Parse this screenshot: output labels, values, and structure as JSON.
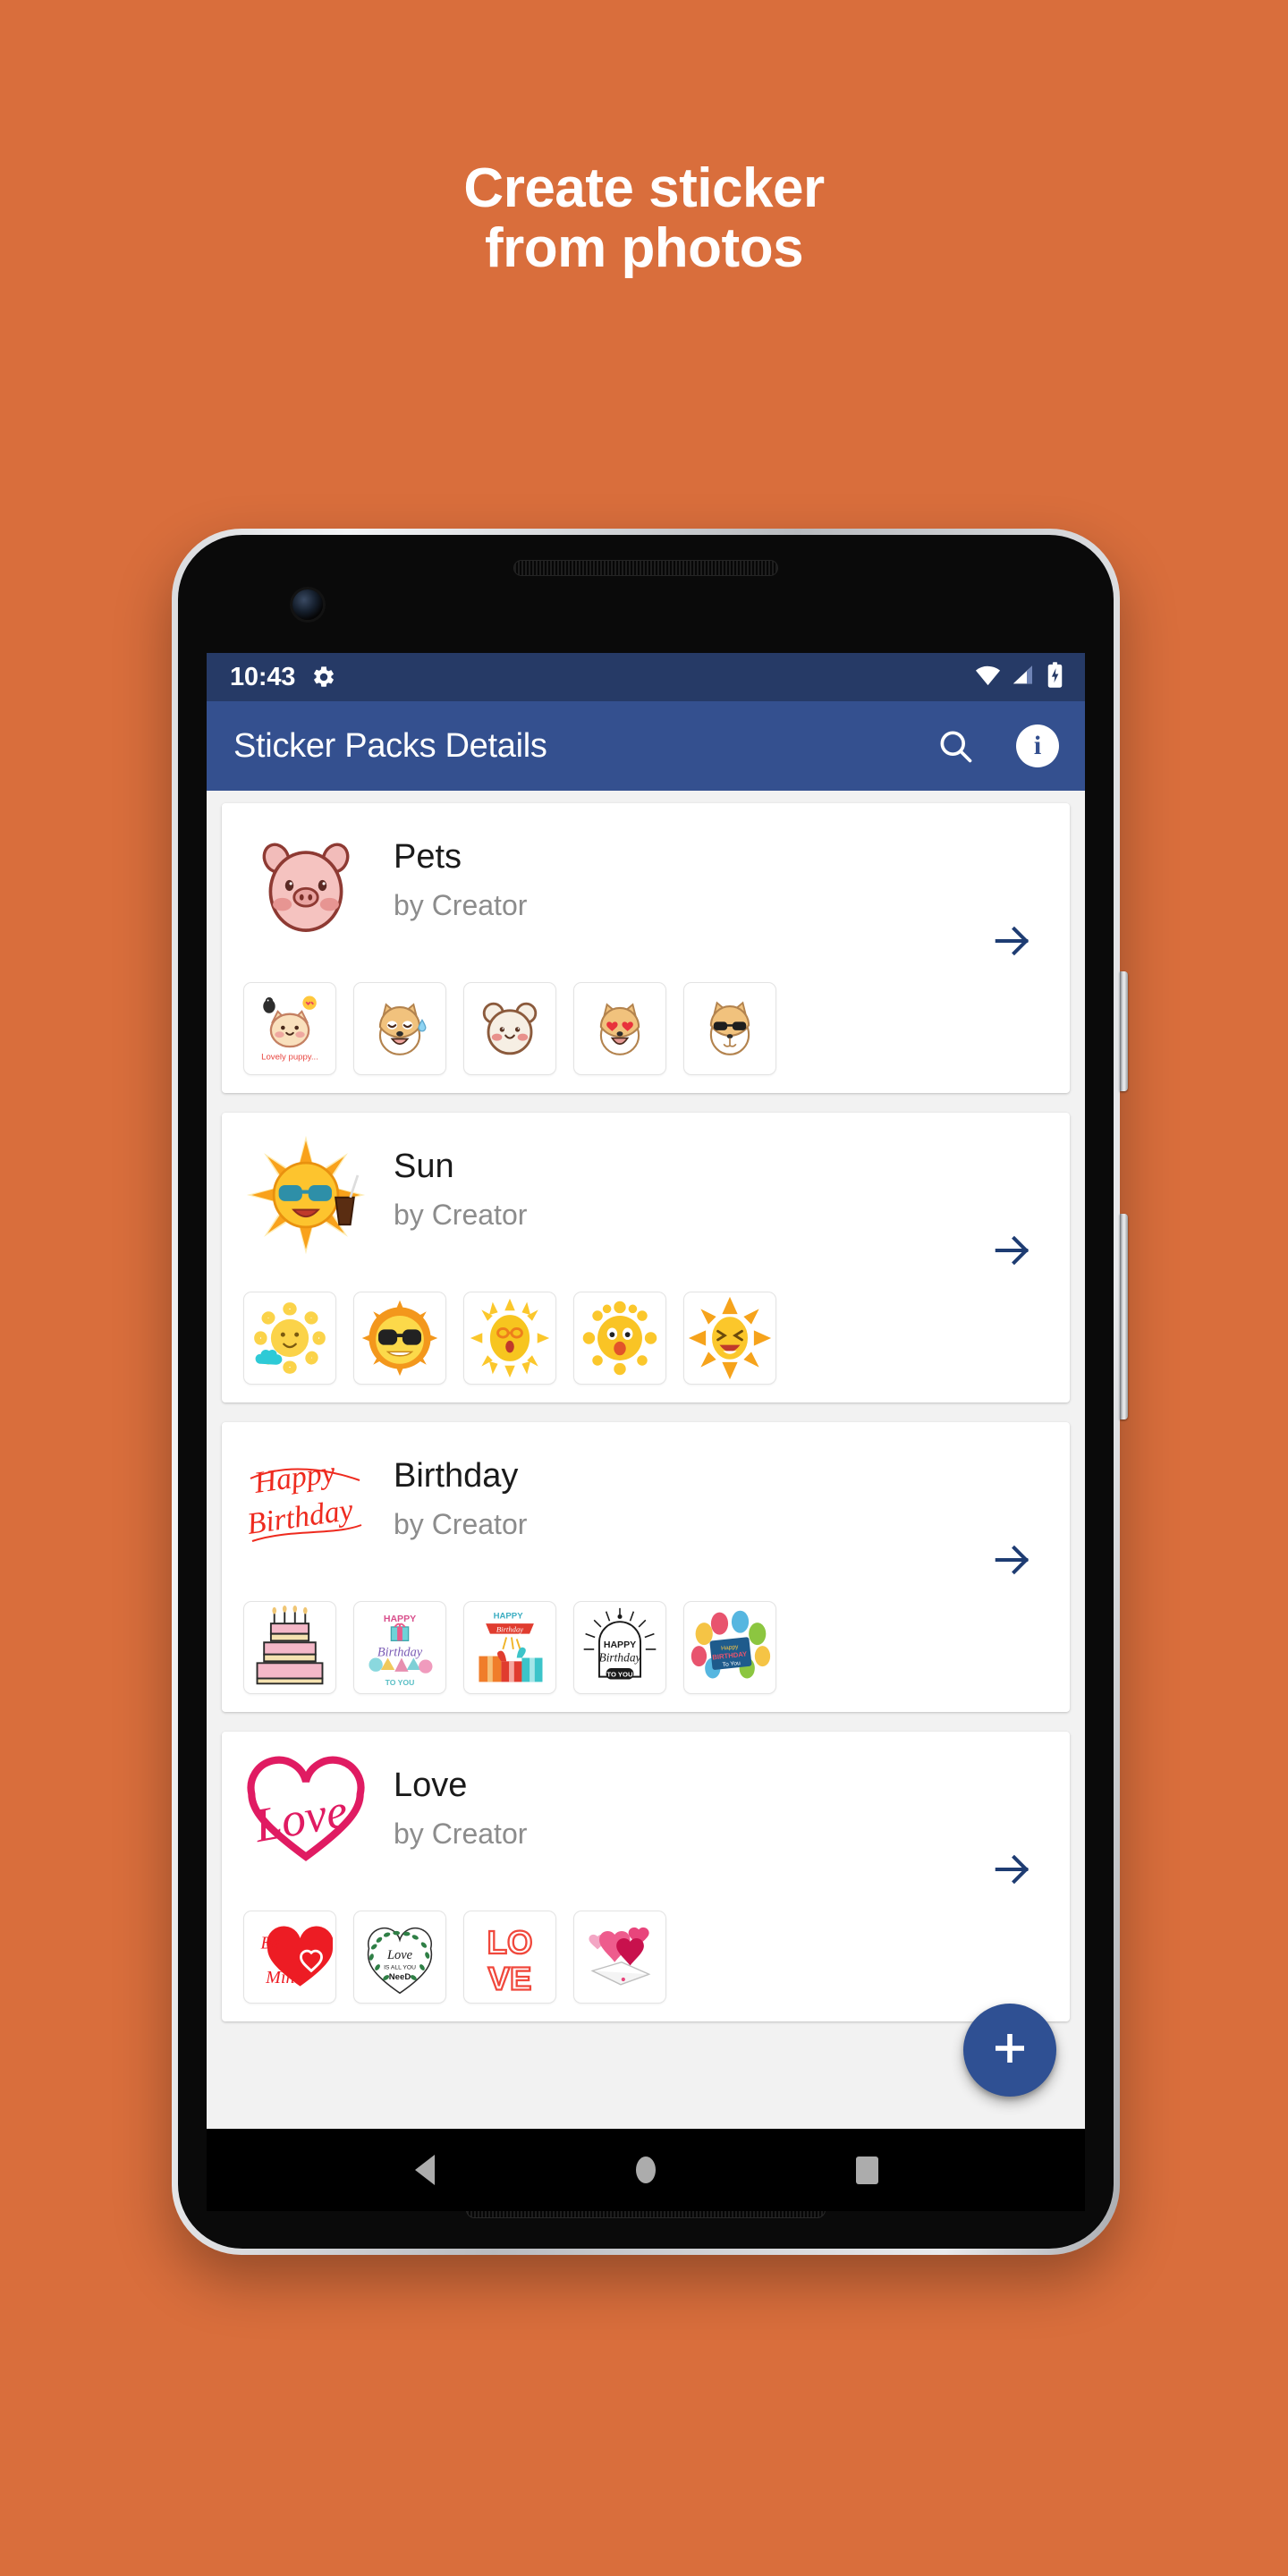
{
  "promo": {
    "line1": "Create sticker",
    "line2": "from photos",
    "background_color": "#D96E3C",
    "text_color": "#FFFFFF"
  },
  "device": {
    "hardware": {
      "earpiece": "earpiece-grille",
      "front_camera": "front-camera",
      "bottom_speaker": "bottom-speaker-grille",
      "power_button": "power-button",
      "volume_button": "volume-rocker"
    }
  },
  "status_bar": {
    "time": "10:43",
    "gear_icon": "gear-icon",
    "icons": [
      "wifi-icon",
      "cell-signal-icon",
      "battery-charging-icon"
    ],
    "background_color": "#263A66"
  },
  "app_bar": {
    "title": "Sticker Packs Details",
    "search_icon": "search-icon",
    "info_icon": "info-icon",
    "info_label": "i",
    "background_color": "#34508F"
  },
  "packs": [
    {
      "name": "Pets",
      "author": "by Creator",
      "avatar_icon": "pig-face-sticker",
      "arrow_icon": "arrow-right-icon",
      "stickers": [
        {
          "icon": "lovely-puppy-sticker",
          "caption": "Lovely puppy..."
        },
        {
          "icon": "shiba-sweat-sticker",
          "caption": ""
        },
        {
          "icon": "panda-face-sticker",
          "caption": ""
        },
        {
          "icon": "shiba-heart-eyes-sticker",
          "caption": ""
        },
        {
          "icon": "shiba-sunglasses-sticker",
          "caption": ""
        }
      ]
    },
    {
      "name": "Sun",
      "author": "by Creator",
      "avatar_icon": "sun-sunglasses-drink-sticker",
      "arrow_icon": "arrow-right-icon",
      "stickers": [
        {
          "icon": "sun-cloud-sticker",
          "caption": ""
        },
        {
          "icon": "sun-black-sunglasses-sticker",
          "caption": ""
        },
        {
          "icon": "sun-orange-glasses-sticker",
          "caption": ""
        },
        {
          "icon": "sun-surprised-sticker",
          "caption": ""
        },
        {
          "icon": "sun-laughing-sticker",
          "caption": ""
        }
      ]
    },
    {
      "name": "Birthday",
      "author": "by Creator",
      "avatar_icon": "happy-birthday-script-sticker",
      "arrow_icon": "arrow-right-icon",
      "stickers": [
        {
          "icon": "birthday-cake-sticker",
          "caption": ""
        },
        {
          "icon": "happy-birthday-to-you-sticker",
          "caption": ""
        },
        {
          "icon": "gift-boxes-sticker",
          "caption": ""
        },
        {
          "icon": "happy-birthday-badge-sticker",
          "caption": ""
        },
        {
          "icon": "birthday-balloons-card-sticker",
          "caption": ""
        }
      ]
    },
    {
      "name": "Love",
      "author": "by Creator",
      "avatar_icon": "love-script-heart-sticker",
      "arrow_icon": "arrow-right-icon",
      "stickers": [
        {
          "icon": "be-mine-heart-sticker",
          "caption": "Be Mine"
        },
        {
          "icon": "love-is-all-you-need-sticker",
          "caption": "Love is all you need"
        },
        {
          "icon": "love-letters-sticker",
          "caption": "LOVE"
        },
        {
          "icon": "heart-balloons-envelope-sticker",
          "caption": ""
        }
      ]
    }
  ],
  "fab": {
    "icon": "plus-icon",
    "label": "+",
    "color": "#2F5093"
  },
  "nav_bar": {
    "back_icon": "nav-back-icon",
    "home_icon": "nav-home-icon",
    "recents_icon": "nav-recents-icon"
  }
}
